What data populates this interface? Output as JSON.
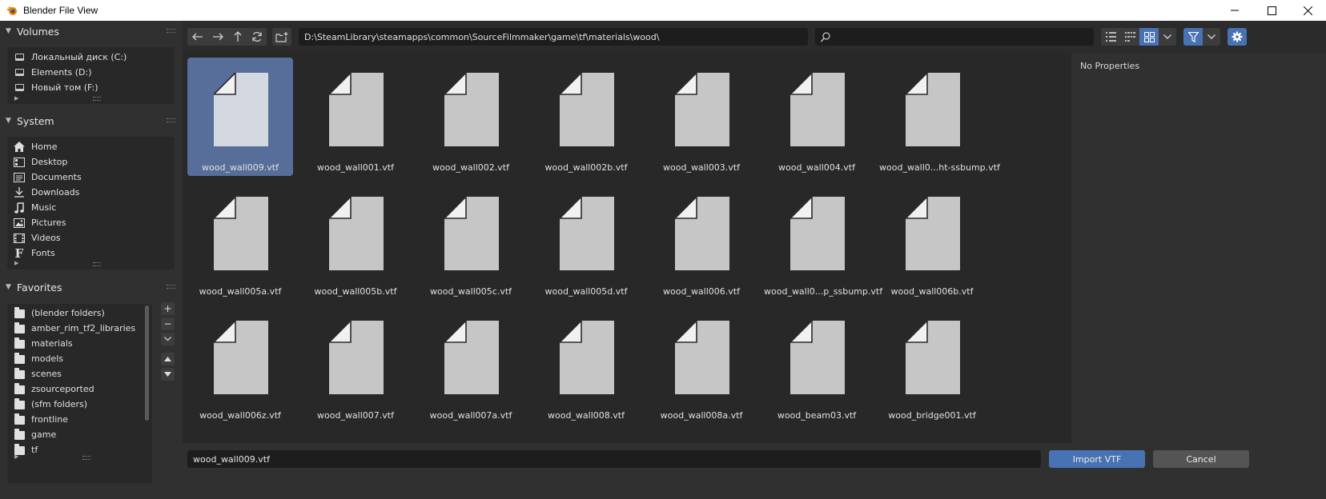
{
  "window": {
    "title": "Blender File View"
  },
  "colors": {
    "accent": "#4772b3",
    "selected_tile": "#566e99",
    "panel": "#303030",
    "field": "#1d1d1d"
  },
  "sidebar": {
    "volumes": {
      "header": "Volumes",
      "items": [
        {
          "label": "Локальный диск (C:)",
          "icon": "drive-icon"
        },
        {
          "label": "Elements (D:)",
          "icon": "drive-icon"
        },
        {
          "label": "Новый том (F:)",
          "icon": "drive-icon"
        }
      ]
    },
    "system": {
      "header": "System",
      "items": [
        {
          "label": "Home",
          "icon": "home-icon"
        },
        {
          "label": "Desktop",
          "icon": "desktop-icon"
        },
        {
          "label": "Documents",
          "icon": "documents-icon"
        },
        {
          "label": "Downloads",
          "icon": "downloads-icon"
        },
        {
          "label": "Music",
          "icon": "music-icon"
        },
        {
          "label": "Pictures",
          "icon": "pictures-icon"
        },
        {
          "label": "Videos",
          "icon": "videos-icon"
        },
        {
          "label": "Fonts",
          "icon": "fonts-icon"
        }
      ]
    },
    "favorites": {
      "header": "Favorites",
      "items": [
        {
          "label": "(blender folders)"
        },
        {
          "label": "amber_rim_tf2_libraries"
        },
        {
          "label": "materials"
        },
        {
          "label": "models"
        },
        {
          "label": "scenes"
        },
        {
          "label": "zsourceported"
        },
        {
          "label": "(sfm folders)"
        },
        {
          "label": "frontline"
        },
        {
          "label": "game"
        },
        {
          "label": "tf"
        }
      ],
      "add_symbol": "+",
      "remove_symbol": "−"
    }
  },
  "toolbar": {
    "path": "D:\\SteamLibrary\\steamapps\\common\\SourceFilmmaker\\game\\tf\\materials\\wood\\",
    "search_value": ""
  },
  "files": [
    {
      "name": "wood_wall009.vtf",
      "selected": true
    },
    {
      "name": "wood_wall001.vtf"
    },
    {
      "name": "wood_wall002.vtf"
    },
    {
      "name": "wood_wall002b.vtf"
    },
    {
      "name": "wood_wall003.vtf"
    },
    {
      "name": "wood_wall004.vtf"
    },
    {
      "name": "wood_wall0...ht-ssbump.vtf"
    },
    {
      "name": "wood_wall005a.vtf"
    },
    {
      "name": "wood_wall005b.vtf"
    },
    {
      "name": "wood_wall005c.vtf"
    },
    {
      "name": "wood_wall005d.vtf"
    },
    {
      "name": "wood_wall006.vtf"
    },
    {
      "name": "wood_wall0...p_ssbump.vtf"
    },
    {
      "name": "wood_wall006b.vtf"
    },
    {
      "name": "wood_wall006z.vtf"
    },
    {
      "name": "wood_wall007.vtf"
    },
    {
      "name": "wood_wall007a.vtf"
    },
    {
      "name": "wood_wall008.vtf"
    },
    {
      "name": "wood_wall008a.vtf"
    },
    {
      "name": "wood_beam03.vtf"
    },
    {
      "name": "wood_bridge001.vtf"
    }
  ],
  "properties": {
    "empty_text": "No Properties"
  },
  "bottom": {
    "filename": "wood_wall009.vtf",
    "import_label": "Import VTF",
    "cancel_label": "Cancel"
  }
}
